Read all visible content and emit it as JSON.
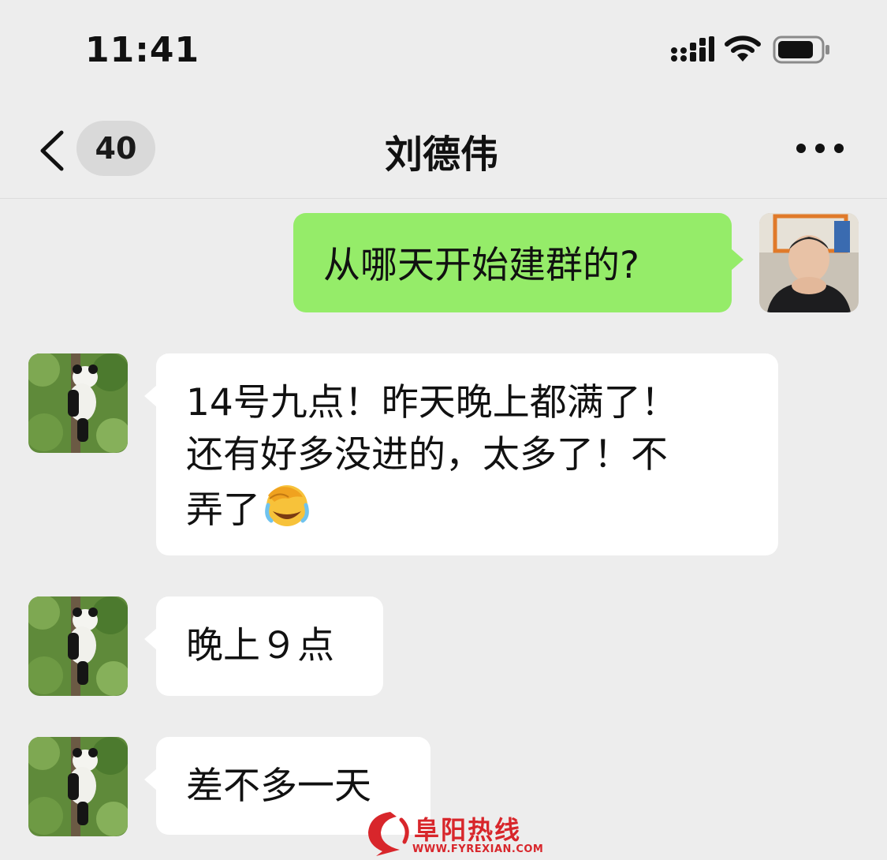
{
  "status_bar": {
    "time": "11:41",
    "icons": [
      "signal-icon",
      "wifi-icon",
      "battery-icon"
    ]
  },
  "nav": {
    "back_icon": "chevron-left-icon",
    "unread_count": "40",
    "title": "刘德伟",
    "more_icon": "more-dots-icon"
  },
  "messages": [
    {
      "sender": "self",
      "text": "从哪天开始建群的?"
    },
    {
      "sender": "other",
      "lines": [
        "14号九点！昨天晚上都满了！",
        "还有好多没进的，太多了！不",
        "弄了"
      ],
      "emoji": "face-palm-crying-emoji"
    },
    {
      "sender": "other",
      "text": "晚上９点"
    },
    {
      "sender": "other",
      "text": "差不多一天"
    }
  ],
  "watermark": {
    "name": "阜阳热线",
    "url": "WWW.FYREXIAN.COM"
  },
  "colors": {
    "background": "#ededed",
    "self_bubble": "#95ec69",
    "other_bubble": "#ffffff",
    "watermark": "#d8262b"
  }
}
